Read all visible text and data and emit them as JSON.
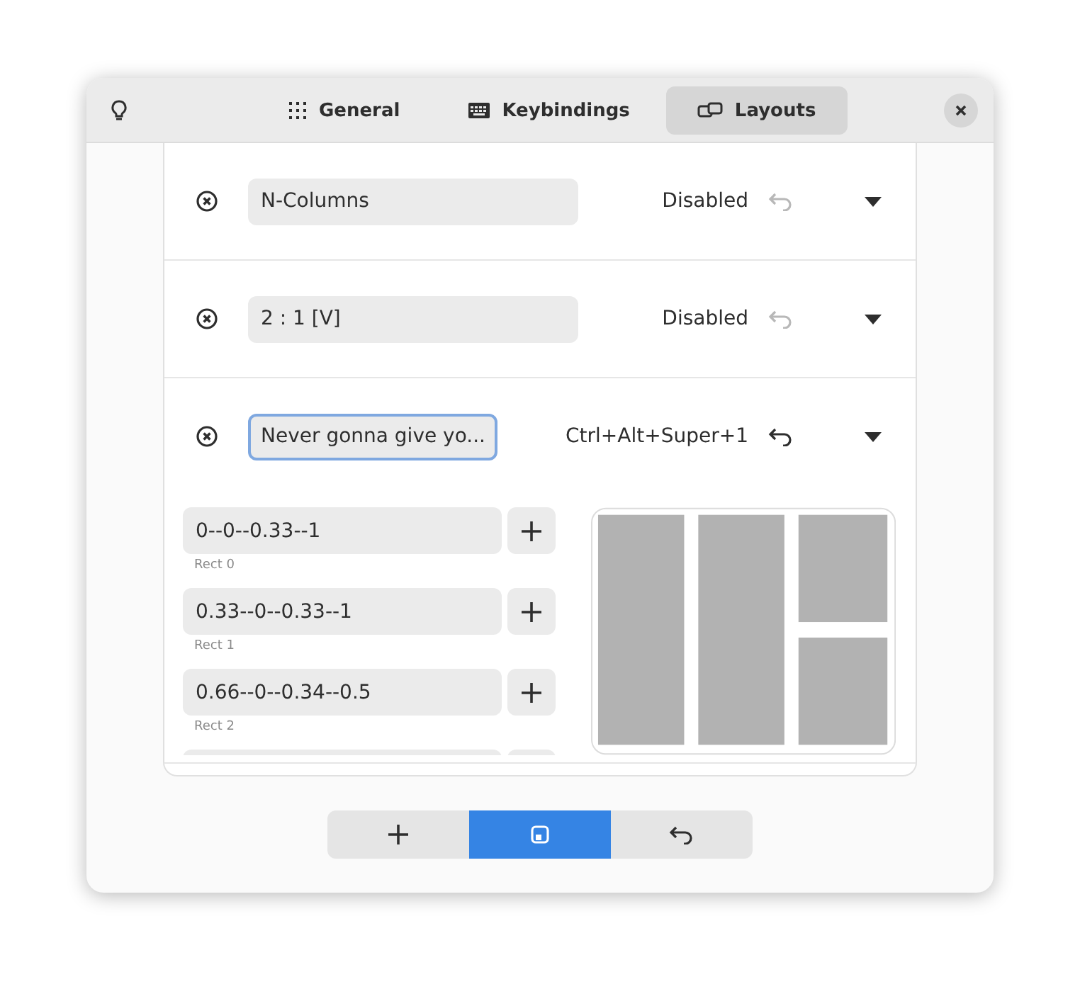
{
  "header": {
    "tabs": [
      {
        "label": "General",
        "selected": false
      },
      {
        "label": "Keybindings",
        "selected": false
      },
      {
        "label": "Layouts",
        "selected": true
      }
    ]
  },
  "layouts": [
    {
      "name": "N-Columns",
      "focused": false,
      "shortcut": "Disabled",
      "reset_enabled": false
    },
    {
      "name": "2 : 1 [V]",
      "focused": false,
      "shortcut": "Disabled",
      "reset_enabled": false
    },
    {
      "name": "Never gonna give yo...",
      "focused": true,
      "shortcut": "Ctrl+Alt+Super+1",
      "reset_enabled": true,
      "rects": [
        {
          "value": "0--0--0.33--1",
          "label": "Rect 0"
        },
        {
          "value": "0.33--0--0.33--1",
          "label": "Rect 1"
        },
        {
          "value": "0.66--0--0.34--0.5",
          "label": "Rect 2"
        }
      ]
    }
  ],
  "actions": [
    {
      "kind": "add",
      "selected": false
    },
    {
      "kind": "save",
      "selected": true
    },
    {
      "kind": "undo",
      "selected": false
    }
  ]
}
